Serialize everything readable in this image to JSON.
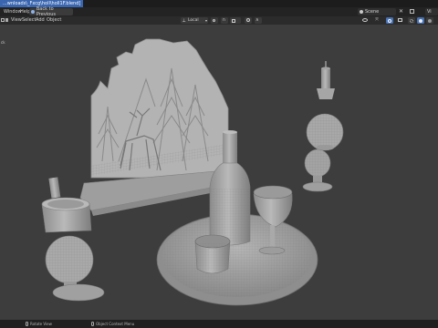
{
  "window": {
    "title": "...wnloads\\_Fxcg\\holl\\holl1F.blend]"
  },
  "menu": {
    "window": "Window",
    "help": "Help",
    "back_to_previous": "Back to Previous",
    "scene_label": "Scene",
    "view_layer_label": "Vi"
  },
  "header": {
    "view": "View",
    "select": "Select",
    "add": "Add",
    "object": "Object",
    "transform_orientation": "Local"
  },
  "status_bar": {
    "rotate_view": "Rotate View",
    "object_context_menu": "Object Context Menu"
  },
  "colors": {
    "title_highlight": "#3a66b0",
    "accent": "#4772b3",
    "viewport_bg": "#3d3d3d",
    "model_gray": "#a8a8a8"
  },
  "icons": [
    "pin-icon",
    "scene-icon",
    "mouse-icon",
    "chevron-down-icon"
  ]
}
